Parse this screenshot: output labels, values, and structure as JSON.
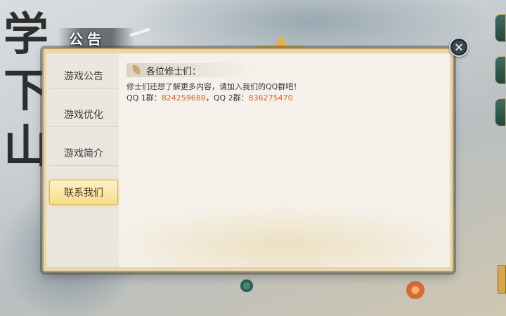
{
  "background": {
    "calligraphy": "学下山"
  },
  "dialog": {
    "title": "公告",
    "close_icon": "close-icon"
  },
  "tabs": [
    {
      "label": "游戏公告",
      "active": false
    },
    {
      "label": "游戏优化",
      "active": false
    },
    {
      "label": "游戏简介",
      "active": false
    },
    {
      "label": "联系我们",
      "active": true
    }
  ],
  "content": {
    "greeting": "各位修士们：",
    "line1": "修士们还想了解更多内容，请加入我们的QQ群吧！",
    "qq1_label": "QQ 1群：",
    "qq1_number": "824259688",
    "separator": "，",
    "qq2_label": "QQ 2群：",
    "qq2_number": "836275470"
  },
  "colors": {
    "accent": "#e2642b",
    "active_tab": "#f5dc8a",
    "frame": "#e6d7ae"
  }
}
